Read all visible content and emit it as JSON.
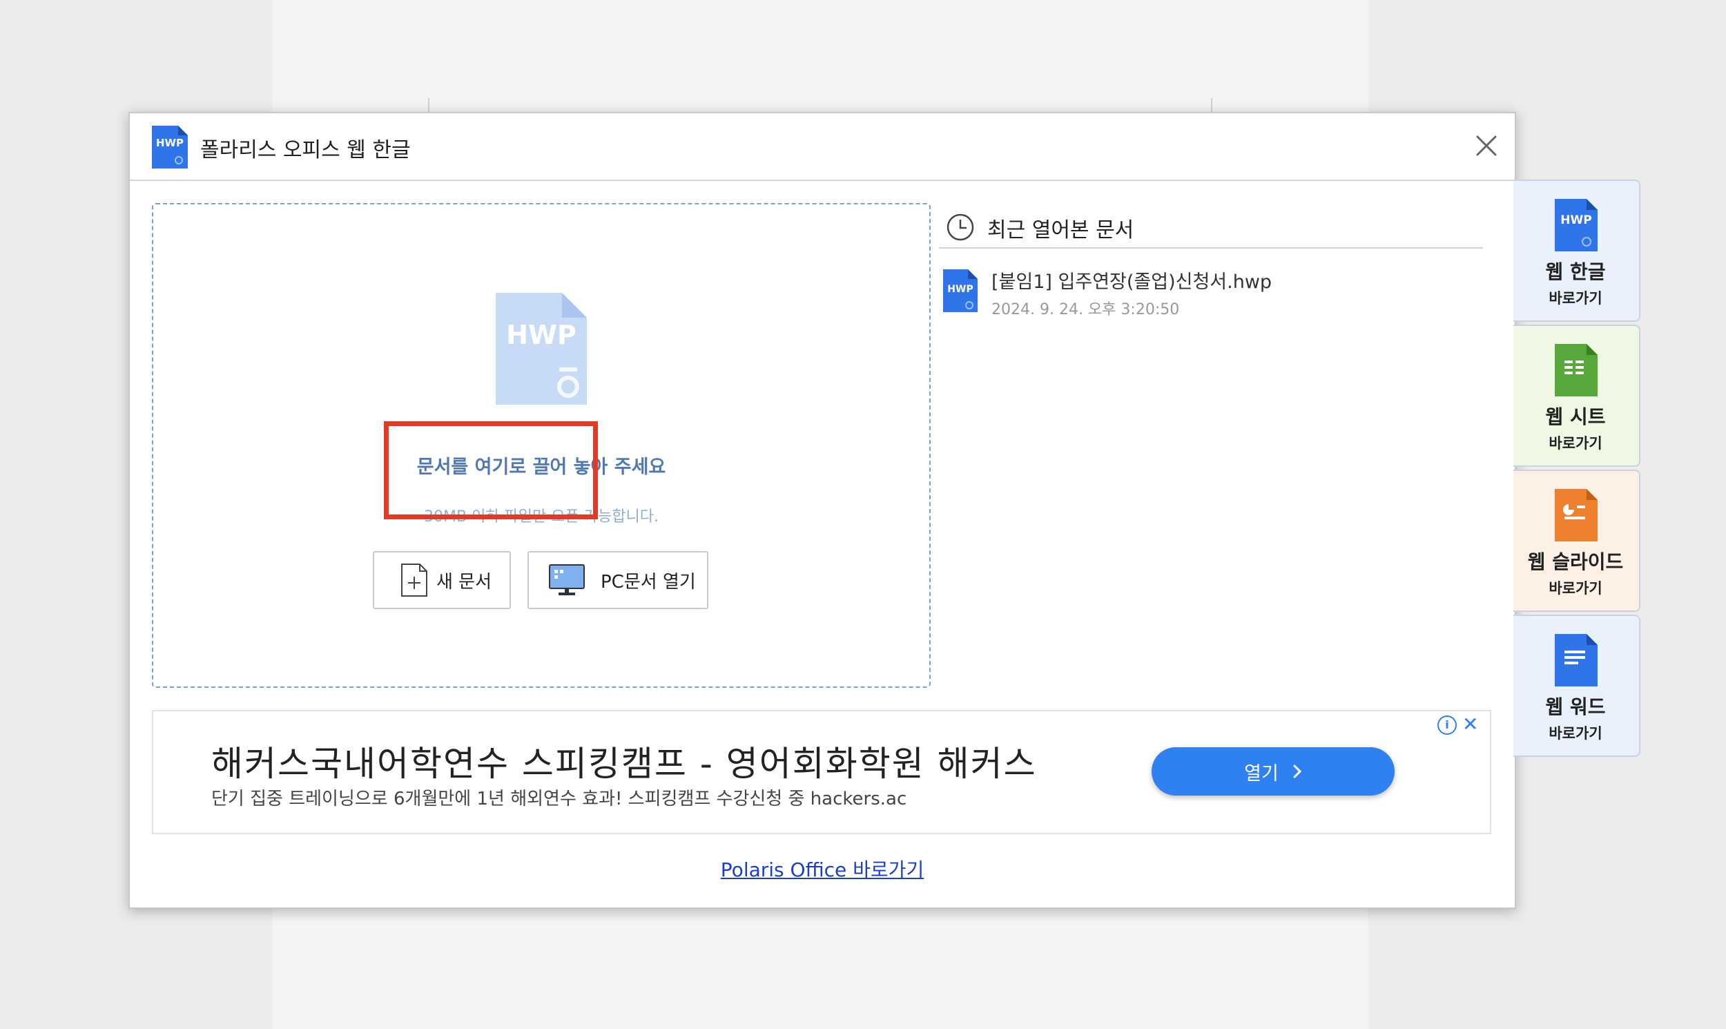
{
  "dialog": {
    "title": "폴라리스 오피스 웹 한글",
    "icon_text": "HWP"
  },
  "dropzone": {
    "icon_text": "HWP",
    "title": "문서를 여기로 끌어 놓아 주세요",
    "subtitle": "30MB 이하 파일만 오픈 가능합니다.",
    "new_doc_label": "새 문서",
    "open_pc_label": "PC문서 열기"
  },
  "recent": {
    "title": "최근 열어본 문서",
    "items": [
      {
        "name": "[붙임1] 입주연장(졸업)신청서.hwp",
        "date": "2024. 9. 24. 오후 3:20:50",
        "icon_text": "HWP"
      }
    ]
  },
  "ad": {
    "title": "해커스국내어학연수 스피킹캠프 - 영어회화학원 해커스",
    "description": "단기 집중 트레이닝으로 6개월만에 1년 해외연수 효과! 스피킹캠프 수강신청 중 hackers.ac",
    "cta_label": "열기"
  },
  "footer": {
    "link_text": "Polaris Office 바로가기"
  },
  "sidebar": {
    "tabs": [
      {
        "name": "웹 한글",
        "go": "바로가기",
        "icon_text": "HWP",
        "bg": "#e9f2fc",
        "icon_color": "#2f74e8"
      },
      {
        "name": "웹 시트",
        "go": "바로가기",
        "bg": "#eef8e2",
        "icon_color": "#56a83a"
      },
      {
        "name": "웹 슬라이드",
        "go": "바로가기",
        "bg": "#fdf1e6",
        "icon_color": "#ee7f2d"
      },
      {
        "name": "웹 워드",
        "go": "바로가기",
        "bg": "#e9f2fc",
        "icon_color": "#2f74e8"
      }
    ]
  },
  "colors": {
    "accent": "#2f80f0",
    "highlight": "#e23a24",
    "link": "#1a3fd0"
  }
}
